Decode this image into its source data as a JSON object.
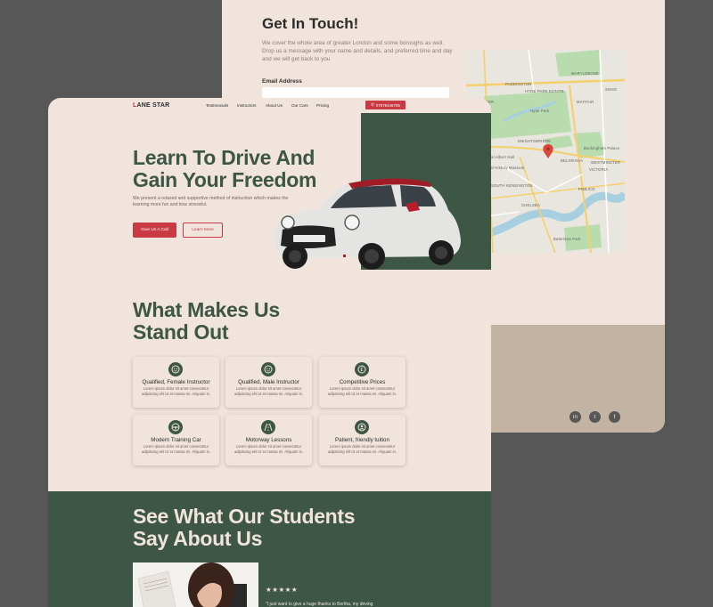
{
  "contact": {
    "title": "Get In Touch!",
    "description": "We cover the whole area of greater London and some boroughs as well. Drop us a message with your name and details, and preferred time and day and we will get back to you",
    "email_label": "Email Address",
    "social": [
      {
        "icon": "linkedin-icon",
        "glyph": "in"
      },
      {
        "icon": "twitter-icon",
        "glyph": "t"
      },
      {
        "icon": "facebook-icon",
        "glyph": "f"
      }
    ]
  },
  "map": {
    "labels": [
      "PADDINGTON",
      "MARYLEBONE",
      "HYDE PARK ESTATE",
      "Hyde Park",
      "BAYSWATER",
      "MAYFAIR",
      "SOHO",
      "BELGRAVIA",
      "VICTORIA",
      "KNIGHTSBRIDGE",
      "Buckingham Palace",
      "CHELSEA",
      "WESTMINSTER",
      "PIMLICO",
      "Battersea Park",
      "SOUTH KENSINGTON",
      "Royal Albert Hall",
      "Natural History Museum"
    ]
  },
  "nav": {
    "logo_first": "L",
    "logo_rest": "ANE STAR",
    "links": [
      "Testimonials",
      "Instructors",
      "About Us",
      "Our Cars",
      "Pricing"
    ],
    "phone": "07575446705"
  },
  "hero": {
    "title_line1": "Learn To Drive And",
    "title_line2": "Gain Your Freedom",
    "description": "We present a relaxed and supportive method of instruction which makes the learning more fun and less stressful.",
    "cta_primary": "Give Us A Call",
    "cta_secondary": "Learn More"
  },
  "standout": {
    "title_line1": "What Makes Us",
    "title_line2": "Stand Out",
    "cards": [
      {
        "title": "Qualified, Female Instructor",
        "text": "Lorem ipsum dolor sit amet consectetur adipiscing elit Ut et massa mi. Aliquam in.",
        "icon": "female-instructor-icon"
      },
      {
        "title": "Qualified, Male Instructor",
        "text": "Lorem ipsum dolor sit amet consectetur adipiscing elit Ut et massa mi. Aliquam in.",
        "icon": "male-instructor-icon"
      },
      {
        "title": "Competitive Prices",
        "text": "Lorem ipsum dolor sit amet consectetur adipiscing elit Ut et massa mi. Aliquam in.",
        "icon": "pound-icon"
      },
      {
        "title": "Modern Training Car",
        "text": "Lorem ipsum dolor sit amet consectetur adipiscing elit Ut et massa mi. Aliquam in.",
        "icon": "steering-wheel-icon"
      },
      {
        "title": "Motorway Lessons",
        "text": "Lorem ipsum dolor sit amet consectetur adipiscing elit Ut et massa mi. Aliquam in.",
        "icon": "road-icon"
      },
      {
        "title": "Patient, friendly tuition",
        "text": "Lorem ipsum dolor sit amet consectetur adipiscing elit Ut et massa mi. Aliquam in.",
        "icon": "smile-icon"
      }
    ]
  },
  "students": {
    "title_line1": "See What Our Students",
    "title_line2": "Say About Us",
    "stars": "★★★★★",
    "rating": 5,
    "quote": "\"I just want to give a huge thanks to Bertha, my driving"
  },
  "colors": {
    "background": "#575757",
    "cream": "#f0e4dc",
    "green": "#3d5646",
    "red": "#c93a42",
    "tan": "#c2b3a3"
  }
}
